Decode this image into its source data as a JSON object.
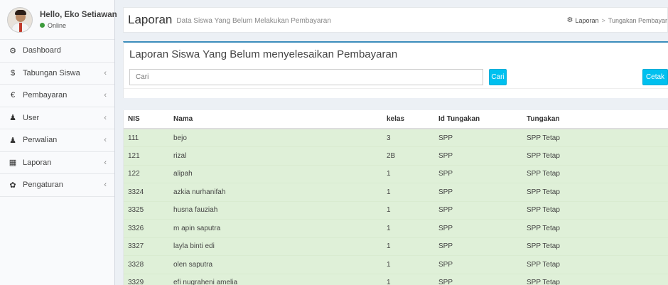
{
  "user": {
    "name": "Hello, Eko Setiawan",
    "status": "Online"
  },
  "sidebar": {
    "items": [
      {
        "label": "Dashboard",
        "icon": "dashboard-icon",
        "glyph": "⚙"
      },
      {
        "label": "Tabungan Siswa",
        "icon": "dollar-icon",
        "glyph": "$",
        "chevron": "‹"
      },
      {
        "label": "Pembayaran",
        "icon": "euro-icon",
        "glyph": "€",
        "chevron": "‹"
      },
      {
        "label": "User",
        "icon": "user-icon",
        "glyph": "♟",
        "chevron": "‹"
      },
      {
        "label": "Perwalian",
        "icon": "user-icon",
        "glyph": "♟",
        "chevron": "‹"
      },
      {
        "label": "Laporan",
        "icon": "chart-icon",
        "glyph": "▦",
        "chevron": "‹"
      },
      {
        "label": "Pengaturan",
        "icon": "gear-icon",
        "glyph": "✿",
        "chevron": "‹"
      }
    ]
  },
  "header": {
    "title": "Laporan",
    "subtitle": "Data Siswa Yang Belum Melakukan Pembayaran",
    "breadcrumb": {
      "home": "Laporan",
      "separator": ">",
      "current": "Tungakan Pembayar"
    }
  },
  "box": {
    "title": "Laporan Siswa Yang Belum menyelesaikan Pembayaran",
    "search_placeholder": "Cari",
    "search_button": "Cari",
    "print_button": "Cetak"
  },
  "table": {
    "columns": [
      "NIS",
      "Nama",
      "kelas",
      "Id Tungakan",
      "Tungakan"
    ],
    "rows": [
      [
        "111",
        "bejo",
        "3",
        "SPP",
        "SPP Tetap"
      ],
      [
        "121",
        "rizal",
        "2B",
        "SPP",
        "SPP Tetap"
      ],
      [
        "122",
        "alipah",
        "1",
        "SPP",
        "SPP Tetap"
      ],
      [
        "3324",
        "azkia nurhanifah",
        "1",
        "SPP",
        "SPP Tetap"
      ],
      [
        "3325",
        "husna fauziah",
        "1",
        "SPP",
        "SPP Tetap"
      ],
      [
        "3326",
        "m apin saputra",
        "1",
        "SPP",
        "SPP Tetap"
      ],
      [
        "3327",
        "layla binti edi",
        "1",
        "SPP",
        "SPP Tetap"
      ],
      [
        "3328",
        "olen saputra",
        "1",
        "SPP",
        "SPP Tetap"
      ],
      [
        "3329",
        "efi nugraheni amelia",
        "1",
        "SPP",
        "SPP Tetap"
      ]
    ]
  },
  "colors": {
    "accent": "#3c8dbc",
    "button": "#00c0ef",
    "row_success": "#dff0d8",
    "online": "#3c9b3c"
  }
}
